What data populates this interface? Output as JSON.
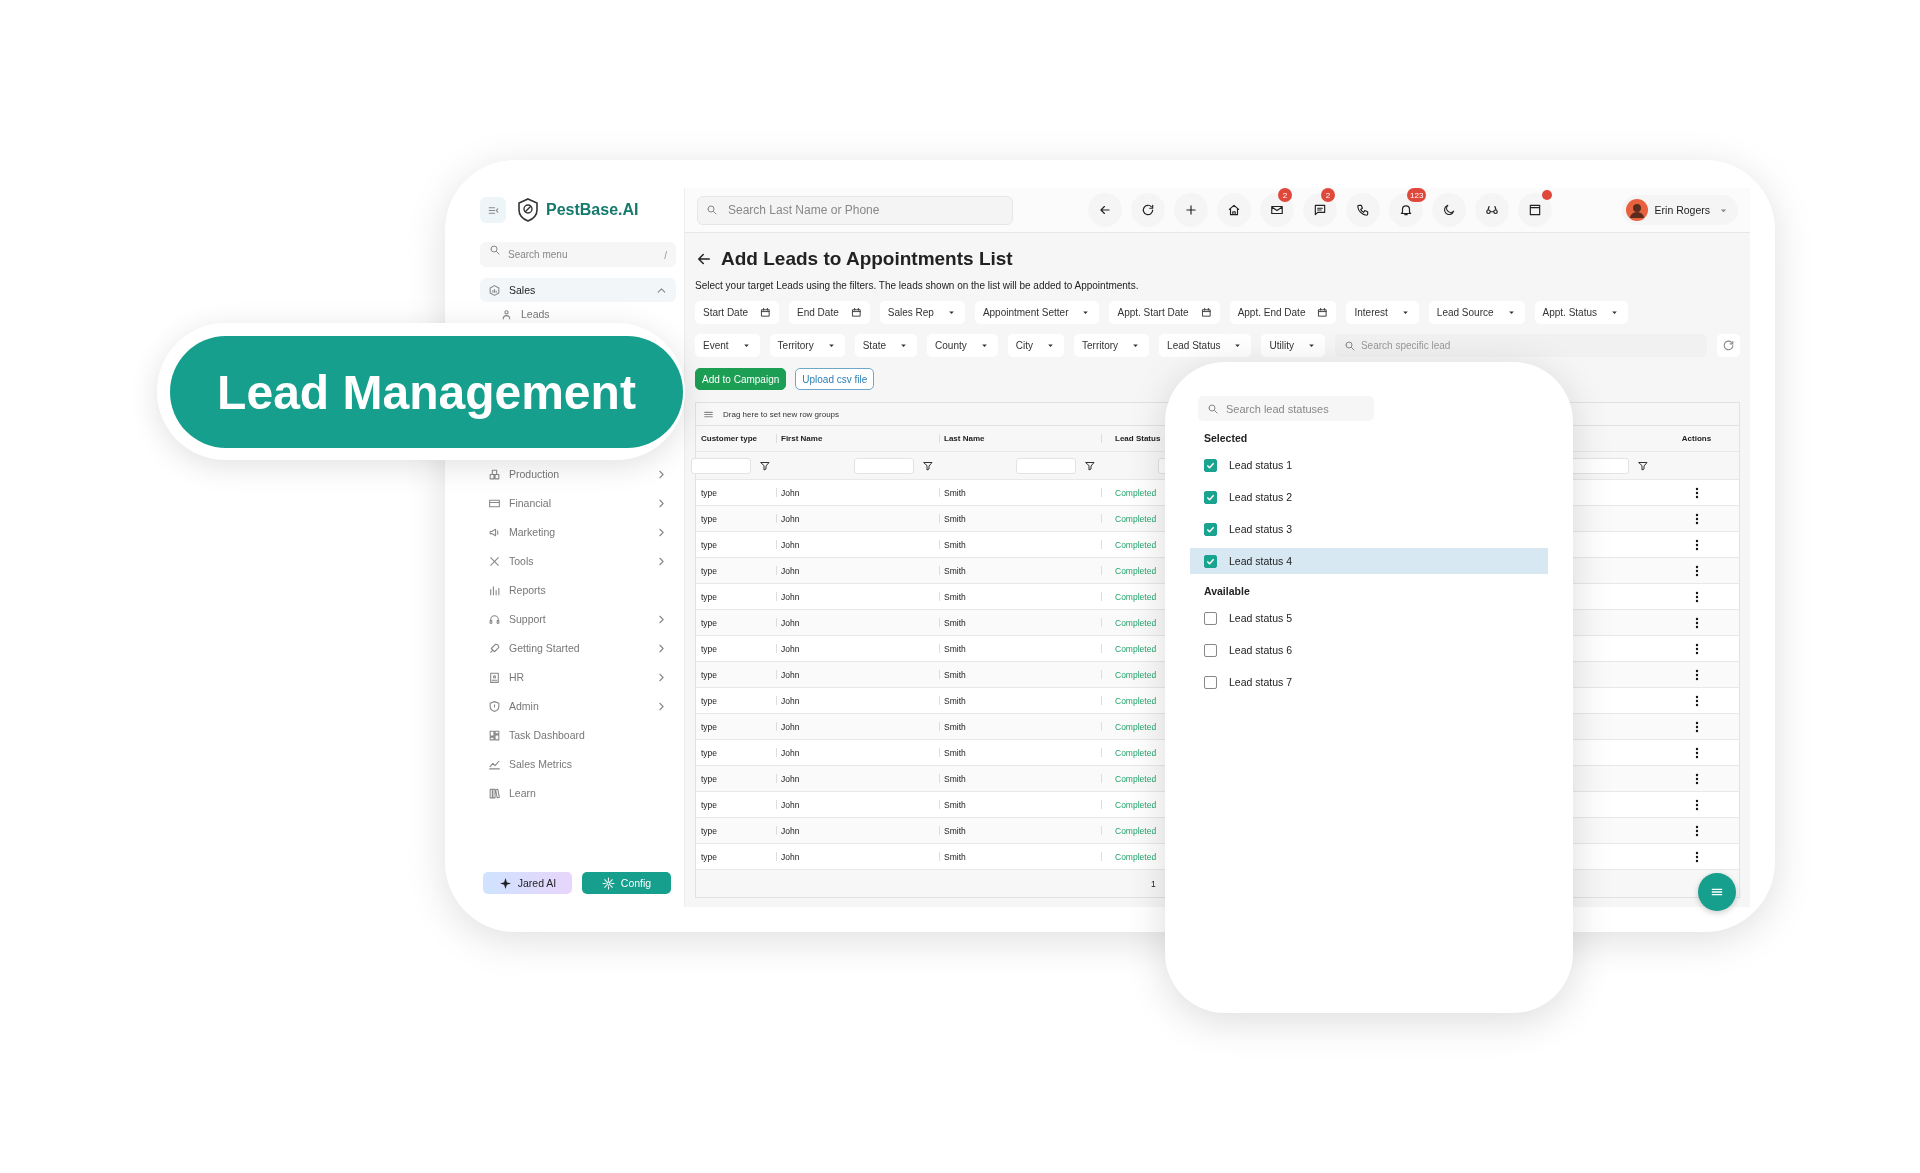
{
  "banner": {
    "label": "Lead Management"
  },
  "sidebar": {
    "brand": "PestBase.AI",
    "search_placeholder": "Search menu",
    "search_shortcut": "/",
    "menu_top": [
      {
        "label": "Sales",
        "expandable": true,
        "expanded": true,
        "children": [
          {
            "label": "Leads"
          }
        ]
      }
    ],
    "menu_lower": [
      {
        "label": "Production",
        "expandable": true,
        "expanded": false
      },
      {
        "label": "Financial",
        "expandable": true,
        "expanded": false
      },
      {
        "label": "Marketing",
        "expandable": true,
        "expanded": false
      },
      {
        "label": "Tools",
        "expandable": true,
        "expanded": false
      },
      {
        "label": "Reports",
        "expandable": false,
        "expanded": false
      },
      {
        "label": "Support",
        "expandable": true,
        "expanded": false
      },
      {
        "label": "Getting Started",
        "expandable": true,
        "expanded": false
      },
      {
        "label": "HR",
        "expandable": true,
        "expanded": false
      },
      {
        "label": "Admin",
        "expandable": true,
        "expanded": false
      },
      {
        "label": "Task Dashboard",
        "expandable": false,
        "expanded": false
      },
      {
        "label": "Sales Metrics",
        "expandable": false,
        "expanded": false
      },
      {
        "label": "Learn",
        "expandable": false,
        "expanded": false
      }
    ],
    "buttons": [
      {
        "label": "Jared AI",
        "kind": "ai"
      },
      {
        "label": "Config",
        "kind": "config"
      }
    ]
  },
  "header": {
    "search_placeholder": "Search Last Name or Phone",
    "icons": [
      {
        "kind": "back",
        "dot": false
      },
      {
        "kind": "refresh",
        "dot": false
      },
      {
        "kind": "add",
        "dot": false
      },
      {
        "kind": "home",
        "dot": false
      },
      {
        "kind": "mail",
        "badge": "2",
        "dot": false
      },
      {
        "kind": "chat",
        "badge": "2",
        "dot": false
      },
      {
        "kind": "phone",
        "dot": false
      },
      {
        "kind": "bell",
        "badge": "123",
        "dot": false
      },
      {
        "kind": "moon",
        "dot": false
      },
      {
        "kind": "glasses",
        "dot": false
      },
      {
        "kind": "window",
        "dot": true
      }
    ],
    "user": {
      "name": "Erin Rogers"
    }
  },
  "page": {
    "title": "Add Leads to Appointments List",
    "description": "Select your target Leads using the filters. The leads shown on the list will be added to Appointments.",
    "filters_row_1": [
      {
        "label": "Start Date",
        "kind": "date"
      },
      {
        "label": "End Date",
        "kind": "date"
      },
      {
        "label": "Sales Rep",
        "kind": "select"
      },
      {
        "label": "Appointment Setter",
        "kind": "select"
      },
      {
        "label": "Appt. Start Date",
        "kind": "date"
      },
      {
        "label": "Appt. End Date",
        "kind": "date"
      },
      {
        "label": "Interest",
        "kind": "select"
      },
      {
        "label": "Lead Source",
        "kind": "select"
      },
      {
        "label": "Appt. Status",
        "kind": "select"
      }
    ],
    "filters_row_2": [
      {
        "label": "Event",
        "kind": "select"
      },
      {
        "label": "Territory",
        "kind": "select"
      },
      {
        "label": "State",
        "kind": "select"
      },
      {
        "label": "County",
        "kind": "select"
      },
      {
        "label": "City",
        "kind": "select"
      },
      {
        "label": "Territory",
        "kind": "select"
      },
      {
        "label": "Lead Status",
        "kind": "select"
      },
      {
        "label": "Utility",
        "kind": "select"
      }
    ],
    "lead_search_placeholder": "Search specific lead",
    "actions": [
      {
        "label": "Add to Campaign",
        "kind": "primary"
      },
      {
        "label": "Upload csv file",
        "kind": "outline"
      }
    ]
  },
  "table": {
    "group_hint": "Drag here to set new row groups",
    "columns": [
      {
        "label": "Customer type",
        "kind": "text"
      },
      {
        "label": "First Name",
        "kind": "text"
      },
      {
        "label": "Last Name",
        "kind": "text"
      },
      {
        "label": "Lead Status",
        "kind": "status"
      },
      {
        "label": "Actions",
        "kind": "actions"
      }
    ],
    "rows": [
      [
        "type",
        "John",
        "Smith",
        "Completed"
      ],
      [
        "type",
        "John",
        "Smith",
        "Completed"
      ],
      [
        "type",
        "John",
        "Smith",
        "Completed"
      ],
      [
        "type",
        "John",
        "Smith",
        "Completed"
      ],
      [
        "type",
        "John",
        "Smith",
        "Completed"
      ],
      [
        "type",
        "John",
        "Smith",
        "Completed"
      ],
      [
        "type",
        "John",
        "Smith",
        "Completed"
      ],
      [
        "type",
        "John",
        "Smith",
        "Completed"
      ],
      [
        "type",
        "John",
        "Smith",
        "Completed"
      ],
      [
        "type",
        "John",
        "Smith",
        "Completed"
      ],
      [
        "type",
        "John",
        "Smith",
        "Completed"
      ],
      [
        "type",
        "John",
        "Smith",
        "Completed"
      ],
      [
        "type",
        "John",
        "Smith",
        "Completed"
      ],
      [
        "type",
        "John",
        "Smith",
        "Completed"
      ],
      [
        "type",
        "John",
        "Smith",
        "Completed"
      ]
    ],
    "footer": "1"
  },
  "lead_status_menu": {
    "search_placeholder": "Search lead statuses",
    "sections": [
      {
        "title": "Selected",
        "items": [
          {
            "label": "Lead status 1",
            "checked": true,
            "highlighted": false
          },
          {
            "label": "Lead status 2",
            "checked": true,
            "highlighted": false
          },
          {
            "label": "Lead status 3",
            "checked": true,
            "highlighted": false
          },
          {
            "label": "Lead status 4",
            "checked": true,
            "highlighted": true
          }
        ]
      },
      {
        "title": "Available",
        "items": [
          {
            "label": "Lead status 5",
            "checked": false,
            "highlighted": false
          },
          {
            "label": "Lead status 6",
            "checked": false,
            "highlighted": false
          },
          {
            "label": "Lead status 7",
            "checked": false,
            "highlighted": false
          }
        ]
      }
    ]
  }
}
